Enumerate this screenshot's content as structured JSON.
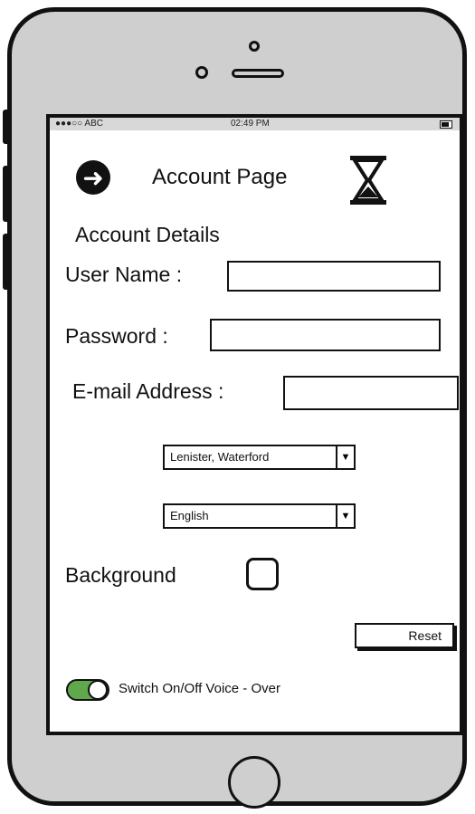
{
  "status_bar": {
    "carrier": "●●●○○ ABC",
    "time": "02:49 PM"
  },
  "header": {
    "back_icon": "arrow-left-circle-icon",
    "title": "Account Page",
    "loading_icon": "hourglass-icon"
  },
  "section_title": "Account Details",
  "fields": {
    "username_label": "User Name :",
    "username_value": "",
    "password_label": "Password :",
    "password_value": "",
    "email_label": "E-mail Address :",
    "email_value": ""
  },
  "location_select": {
    "selected": "Lenister, Waterford"
  },
  "language_select": {
    "selected": "English"
  },
  "background": {
    "label": "Background",
    "checked": false
  },
  "reset_label": "Reset",
  "voice_over": {
    "label": "Switch On/Off Voice - Over",
    "on": true,
    "on_color": "#5fa84c"
  }
}
